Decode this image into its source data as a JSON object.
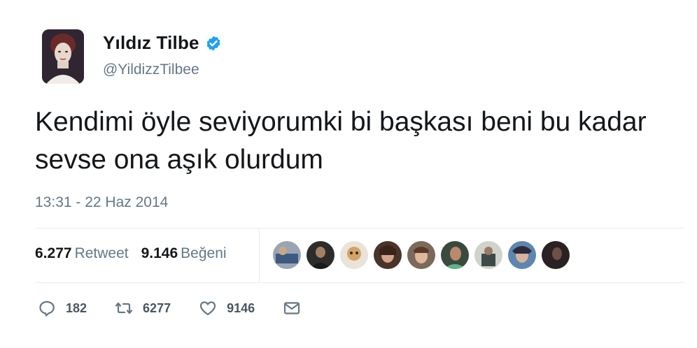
{
  "user": {
    "display_name": "Yıldız Tilbe",
    "handle": "@YildizzTilbee",
    "verified_icon": "verified-badge-icon",
    "accent": "#1da1f2"
  },
  "tweet": {
    "text": "Kendimi öyle seviyorumki bi başkası beni bu kadar sevse ona aşık olurdum",
    "timestamp": "13:31 - 22 Haz 2014"
  },
  "stats": {
    "retweets_count": "6.277",
    "retweets_label": "Retweet",
    "likes_count": "9.146",
    "likes_label": "Beğeni"
  },
  "likers": [
    {
      "icon": "liker-avatar"
    },
    {
      "icon": "liker-avatar"
    },
    {
      "icon": "liker-avatar"
    },
    {
      "icon": "liker-avatar"
    },
    {
      "icon": "liker-avatar"
    },
    {
      "icon": "liker-avatar"
    },
    {
      "icon": "liker-avatar"
    },
    {
      "icon": "liker-avatar"
    },
    {
      "icon": "liker-avatar"
    }
  ],
  "actions": {
    "reply": {
      "icon": "reply-icon",
      "count": "182"
    },
    "retweet": {
      "icon": "retweet-icon",
      "count": "6277"
    },
    "like": {
      "icon": "heart-icon",
      "count": "9146"
    },
    "message": {
      "icon": "envelope-icon"
    }
  }
}
